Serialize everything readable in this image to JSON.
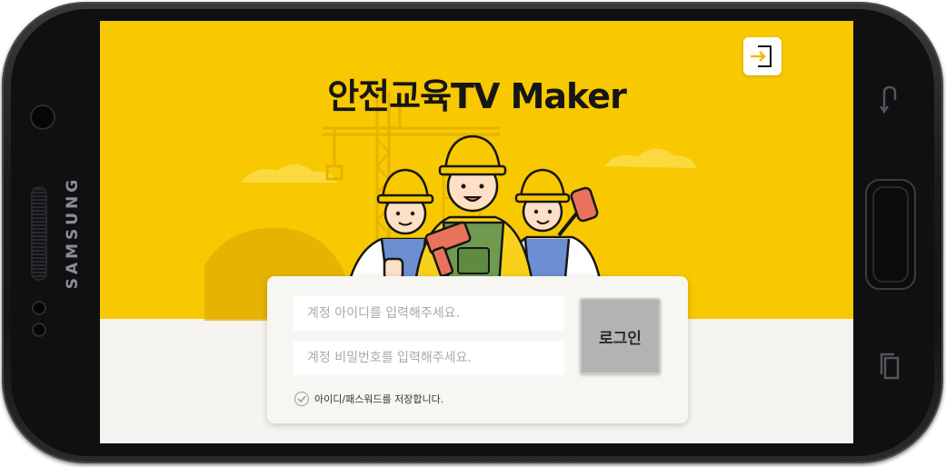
{
  "device": {
    "brand_text": "SAMSUNG",
    "left_icons": [
      "front-camera-icon",
      "sensor-icon"
    ],
    "right_icons": [
      "back-key-icon",
      "home-key-icon",
      "recent-apps-icon"
    ]
  },
  "app": {
    "title": "안전교육TV Maker",
    "exit_icon": "exit-login-icon",
    "accent_color": "#f8c800"
  },
  "login": {
    "id_placeholder": "계정 아이디를 입력해주세요.",
    "id_value": "",
    "password_placeholder": "계정 비밀번호를 입력해주세요.",
    "password_value": "",
    "submit_label": "로그인",
    "remember_label": "아이디/패스워드를 저장합니다.",
    "remember_checked": false
  }
}
